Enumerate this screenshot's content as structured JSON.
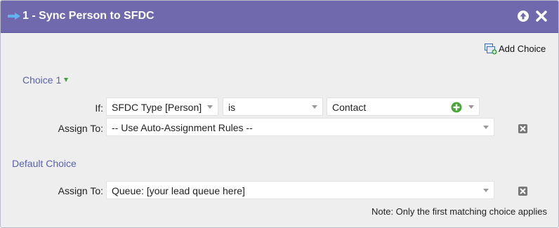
{
  "header": {
    "title": "1 - Sync Person to SFDC",
    "colors": {
      "bar": "#7069ad"
    }
  },
  "toolbar": {
    "add_choice_label": "Add Choice"
  },
  "choice1": {
    "title": "Choice 1",
    "if_label": "If:",
    "field_select": "SFDC Type [Person]",
    "operator_select": "is",
    "value_select": "Contact",
    "assign_label": "Assign To:",
    "assign_select": "-- Use Auto-Assignment Rules --"
  },
  "default_choice": {
    "title": "Default Choice",
    "assign_label": "Assign To:",
    "assign_select": "Queue: [your lead queue here]"
  },
  "note": "Note: Only the first matching choice applies"
}
